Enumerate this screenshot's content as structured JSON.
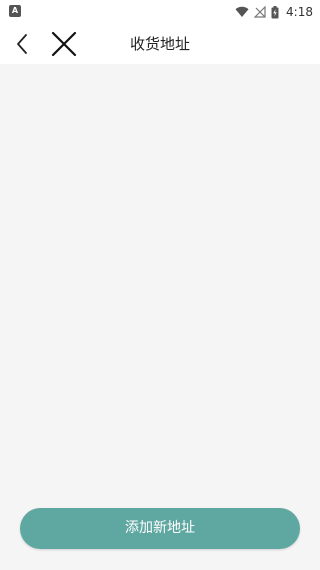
{
  "status_bar": {
    "time": "4:18",
    "icons": [
      "notification-a-icon",
      "wifi-icon",
      "no-signal-icon",
      "battery-charging-icon"
    ]
  },
  "nav": {
    "title": "收货地址",
    "back_icon": "chevron-left-icon",
    "close_icon": "close-icon"
  },
  "footer": {
    "add_button_label": "添加新地址",
    "accent_color": "#5fa8a1"
  }
}
